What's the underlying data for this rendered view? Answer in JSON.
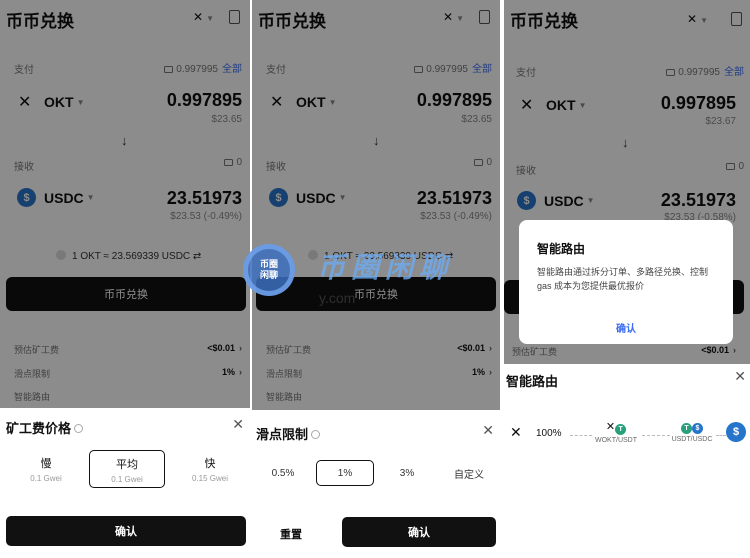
{
  "app_title": "币币兑换",
  "network_icon": "okx-logo",
  "pay": {
    "label": "支付",
    "balance": "0.997995",
    "max_label": "全部",
    "token": "OKT",
    "amount": "0.997895",
    "usd_p1": "$23.65",
    "usd_p3": "$23.67"
  },
  "receive": {
    "label": "接收",
    "balance": "0",
    "token": "USDC",
    "amount": "23.51973",
    "usd_p1": "$23.53 (-0.49%)",
    "usd_p3": "$23.53 (-0.58%)"
  },
  "rate_text": "1 OKT ≈ 23.569339 USDC",
  "swap_button": "币币兑换",
  "fee": {
    "gas_label": "预估矿工费",
    "gas_value": "<$0.01",
    "slippage_label": "滑点限制",
    "slippage_value": "1%",
    "route_label": "智能路由"
  },
  "gas_sheet": {
    "title": "矿工费价格",
    "options": [
      {
        "name": "慢",
        "gwei": "0.1 Gwei"
      },
      {
        "name": "平均",
        "gwei": "0.1 Gwei"
      },
      {
        "name": "快",
        "gwei": "0.15 Gwei"
      }
    ],
    "selected_index": 1,
    "confirm": "确认"
  },
  "slippage_sheet": {
    "title": "滑点限制",
    "options": [
      "0.5%",
      "1%",
      "3%",
      "自定义"
    ],
    "selected_index": 1,
    "reset": "重置",
    "confirm": "确认"
  },
  "route_dialog": {
    "title": "智能路由",
    "body": "智能路由通过拆分订单、多路径兑换、控制 gas 成本为您提供最优报价",
    "confirm": "确认"
  },
  "route_panel": {
    "title": "智能路由",
    "percent": "100%",
    "hop1": "WOKT/USDT",
    "hop2": "USDT/USDC"
  },
  "watermark": {
    "badge_line1": "币圈",
    "badge_line2": "闲聊",
    "text": "币圈闲聊",
    "url": "y.com"
  },
  "colors": {
    "accent": "#3a6df0",
    "usdc": "#2775ca",
    "dark": "#111111"
  }
}
